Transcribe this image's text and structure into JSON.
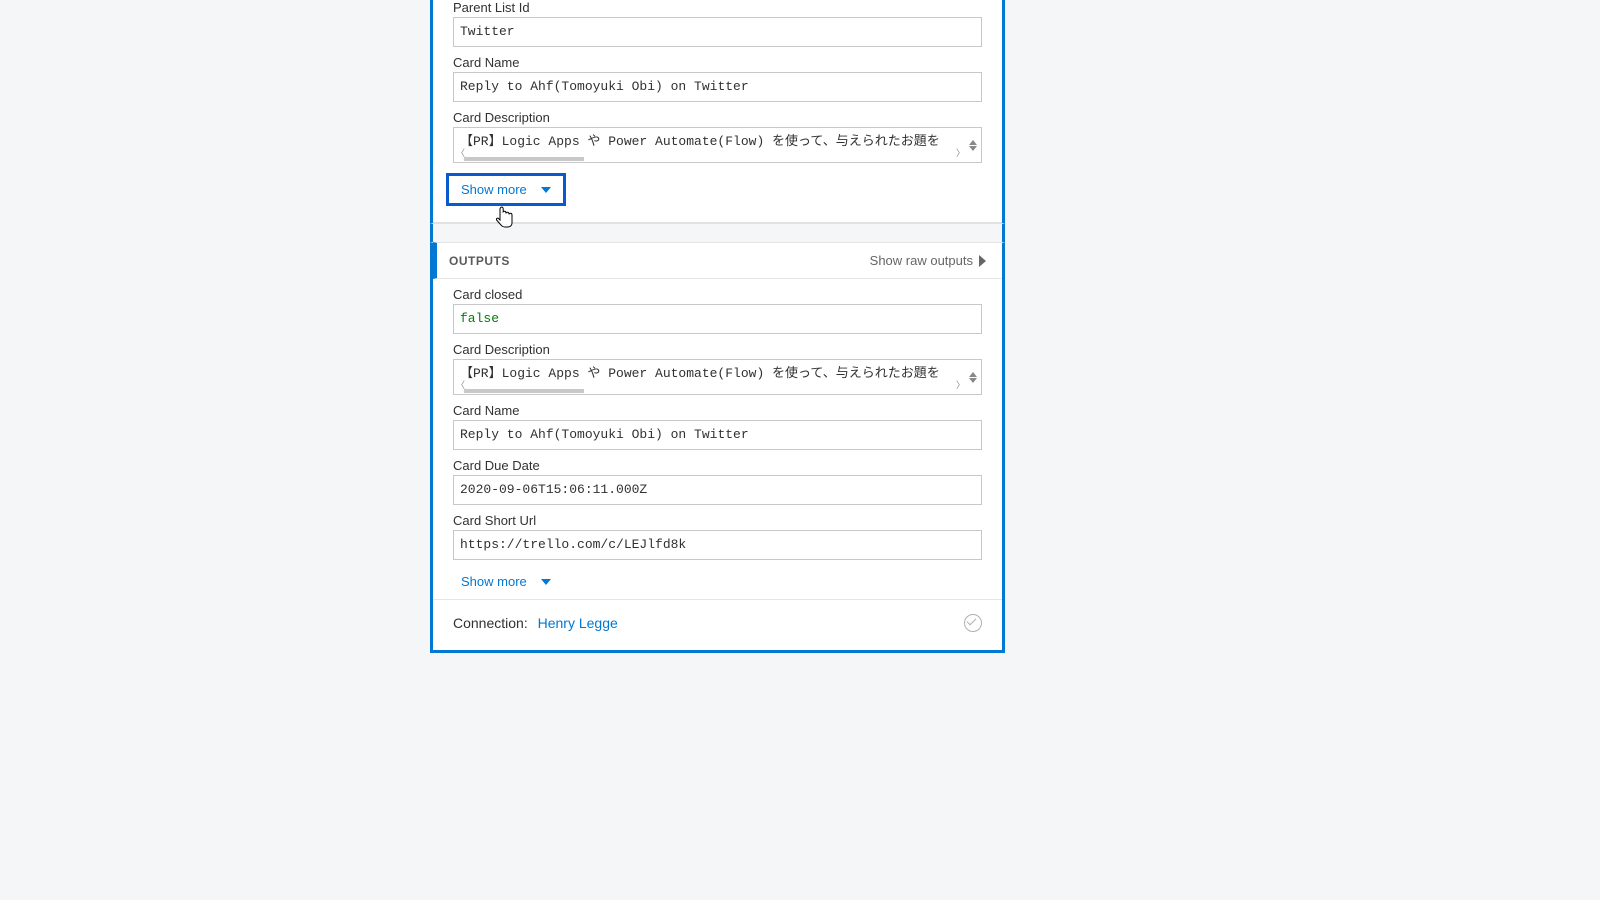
{
  "inputs": {
    "parent_list_id_label": "Parent List Id",
    "parent_list_id_value": "Twitter",
    "card_name_label": "Card Name",
    "card_name_value": "Reply to Ahf(Tomoyuki Obi) on Twitter",
    "card_desc_label": "Card Description",
    "card_desc_value": "【PR】Logic Apps や Power Automate(Flow) を使って、与えられたお題を",
    "show_more_label": "Show more"
  },
  "outputs": {
    "section_title": "OUTPUTS",
    "show_raw_label": "Show raw outputs",
    "card_closed_label": "Card closed",
    "card_closed_value": "false",
    "card_desc_label": "Card Description",
    "card_desc_value": "【PR】Logic Apps や Power Automate(Flow) を使って、与えられたお題を",
    "card_name_label": "Card Name",
    "card_name_value": "Reply to Ahf(Tomoyuki Obi) on Twitter",
    "card_due_label": "Card Due Date",
    "card_due_value": "2020-09-06T15:06:11.000Z",
    "card_url_label": "Card Short Url",
    "card_url_value": "https://trello.com/c/LEJlfd8k",
    "show_more_label": "Show more"
  },
  "footer": {
    "connection_label": "Connection:",
    "connection_name": "Henry Legge"
  }
}
